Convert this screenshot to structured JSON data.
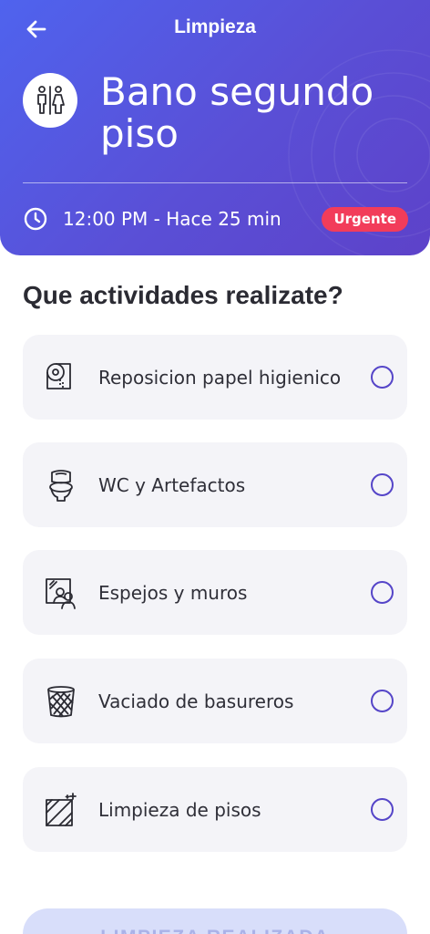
{
  "header": {
    "title": "Limpieza",
    "page_title": "Bano segundo piso",
    "time_text": "12:00 PM - Hace 25 min",
    "badge": "Urgente",
    "gradient_start": "#4f63ee",
    "gradient_end": "#5d42c9",
    "badge_color": "#f23c5a"
  },
  "section_title": "Que actividades realizate?",
  "activities": [
    {
      "label": "Reposicion papel higienico",
      "icon": "toilet-paper-icon",
      "checked": false
    },
    {
      "label": "WC y Artefactos",
      "icon": "toilet-icon",
      "checked": false
    },
    {
      "label": "Espejos y muros",
      "icon": "mirror-icon",
      "checked": false
    },
    {
      "label": "Vaciado de basureros",
      "icon": "trash-bin-icon",
      "checked": false
    },
    {
      "label": "Limpieza de pisos",
      "icon": "floor-tiles-icon",
      "checked": false
    }
  ],
  "submit_label": "LIMPIEZA REALIZADA",
  "accent_color": "#5545c8"
}
